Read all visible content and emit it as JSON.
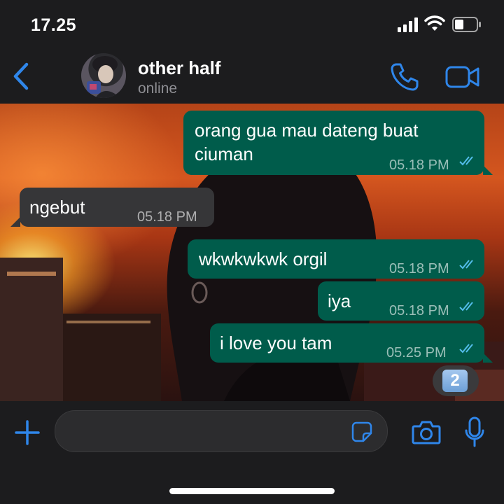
{
  "status_bar": {
    "time": "17.25"
  },
  "header": {
    "contact_name": "other half",
    "presence": "online"
  },
  "messages": [
    {
      "direction": "outgoing",
      "text_line1": "orang gua mau dateng buat",
      "text_line2": "ciuman",
      "time": "05.18 PM",
      "status": "read"
    },
    {
      "direction": "incoming",
      "text": "ngebut",
      "time": "05.18 PM"
    },
    {
      "direction": "outgoing",
      "text": "wkwkwkwk orgil",
      "time": "05.18 PM",
      "status": "read"
    },
    {
      "direction": "outgoing",
      "text": "iya",
      "time": "05.18 PM",
      "status": "read"
    },
    {
      "direction": "outgoing",
      "text": "i love you tam",
      "time": "05.25 PM",
      "status": "read"
    }
  ],
  "unread_badge": "2",
  "colors": {
    "accent": "#2f86ea",
    "outgoing_bubble": "#005c4b",
    "incoming_bubble": "#363638",
    "read_ticks": "#53bdeb"
  },
  "icons": [
    "back-chevron-icon",
    "phone-icon",
    "video-camera-icon",
    "plus-icon",
    "sticker-icon",
    "camera-icon",
    "microphone-icon"
  ]
}
